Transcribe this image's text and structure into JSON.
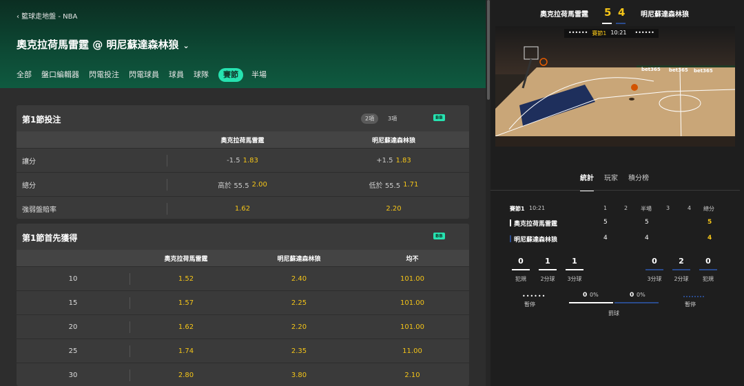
{
  "breadcrumb": "‹ 籃球走地盤 - NBA",
  "match_title": "奧克拉荷馬雷霆 @ 明尼蘇達森林狼",
  "title_chevron": "⌄",
  "tabs": [
    "全部",
    "盤口編輯器",
    "閃電投注",
    "閃電球員",
    "球員",
    "球隊",
    "賽節",
    "半場"
  ],
  "active_tab": "賽節",
  "card1": {
    "title": "第1節投注",
    "pill_a": "2項",
    "pill_b": "3項",
    "badge": "BB",
    "col_home": "奧克拉荷馬雷霆",
    "col_away": "明尼蘇達森林狼",
    "rows": [
      {
        "label": "讓分",
        "home_sub": "-1.5",
        "home_odds": "1.83",
        "away_sub": "+1.5",
        "away_odds": "1.83"
      },
      {
        "label": "總分",
        "home_sub": "高於 55.5",
        "home_odds": "2.00",
        "away_sub": "低於 55.5",
        "away_odds": "1.71"
      },
      {
        "label": "強弱盤賠率",
        "home_sub": "",
        "home_odds": "1.62",
        "away_sub": "",
        "away_odds": "2.20"
      }
    ]
  },
  "card2": {
    "title": "第1節首先獲得",
    "badge": "BB",
    "col_home": "奧克拉荷馬雷霆",
    "col_away": "明尼蘇達森林狼",
    "col_draw": "均不",
    "rows": [
      {
        "label": "10",
        "home": "1.52",
        "away": "2.40",
        "draw": "101.00"
      },
      {
        "label": "15",
        "home": "1.57",
        "away": "2.25",
        "draw": "101.00"
      },
      {
        "label": "20",
        "home": "1.62",
        "away": "2.20",
        "draw": "101.00"
      },
      {
        "label": "25",
        "home": "1.74",
        "away": "2.35",
        "draw": "11.00"
      },
      {
        "label": "30",
        "home": "2.80",
        "away": "3.80",
        "draw": "2.10"
      }
    ]
  },
  "scoreboard": {
    "home": "奧克拉荷馬雷霆",
    "away": "明尼蘇達森林狼",
    "home_score": "5",
    "away_score": "4",
    "overlay_period": "賽節1",
    "overlay_time": "10:21",
    "overlay_dots_left": "••••••",
    "overlay_dots_right": "••••••",
    "ad_text": "bet365"
  },
  "stats_tabs": [
    "統計",
    "玩家",
    "積分榜"
  ],
  "stats_active": "統計",
  "table": {
    "period_label": "賽節1",
    "clock": "10:21",
    "headers": [
      "1",
      "2",
      "半場",
      "3",
      "4",
      "總分"
    ],
    "home_name": "奧克拉荷馬雷霆",
    "away_name": "明尼蘇達森林狼",
    "home_q1": "5",
    "home_half": "5",
    "home_total": "5",
    "away_q1": "4",
    "away_half": "4",
    "away_total": "4"
  },
  "stats": {
    "home_fouls": "0",
    "home_2pt": "1",
    "home_3pt": "1",
    "away_3pt": "0",
    "away_2pt": "2",
    "away_fouls": "0",
    "lbl_fouls": "犯規",
    "lbl_2pt": "2分球",
    "lbl_3pt": "3分球",
    "timeout_home_dots": "••••••",
    "timeout_label": "暫停",
    "ft_home_count": "0",
    "ft_home_pct": "0%",
    "ft_away_count": "0",
    "ft_away_pct": "0%",
    "ft_label": "罰球",
    "colors": {
      "home": "#ffffff",
      "away": "#2a4b8d",
      "odds": "#f5c518",
      "accent": "#26e2b0"
    }
  }
}
